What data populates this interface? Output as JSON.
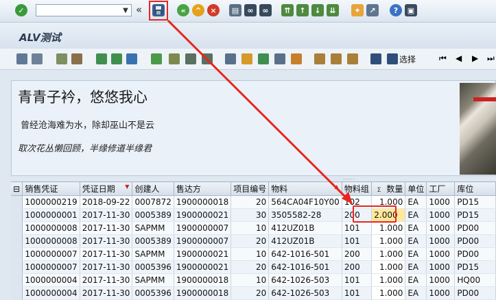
{
  "colors": {
    "highlight": "#e8251f",
    "toolbar_bg": "#dbe5ef",
    "row_alt": "#eef3fa",
    "edit_cell": "#ffe89b"
  },
  "toolbar": {
    "command_field": "",
    "icons": [
      "check-icon",
      "nav-back-icon",
      "save-icon",
      "back-icon",
      "exit-icon",
      "cancel-icon",
      "print-icon",
      "find-icon",
      "find-next-icon",
      "first-page-icon",
      "prev-page-icon",
      "next-page-icon",
      "last-page-icon",
      "create-session-icon",
      "shortcut-icon",
      "help-icon",
      "layout-icon"
    ]
  },
  "title": "ALV测试",
  "app_toolbar": {
    "select_label": "选择"
  },
  "header": {
    "line1": "青青子衿，悠悠我心",
    "line2": "曾经沧海难为水，除却巫山不是云",
    "line3": "取次花丛懒回顾，半缘修道半缘君",
    "separator": "....."
  },
  "grid": {
    "columns": [
      "销售凭证",
      "凭证日期",
      "创建人",
      "售达方",
      "项目编号",
      "物料",
      "物料组",
      "数量",
      "单位",
      "工厂",
      "库位"
    ],
    "sigma": "Σ",
    "rows": [
      [
        "1000000219",
        "2018-09-22",
        "0007872",
        "1900000018",
        "20",
        "564CA04F10Y00",
        "102",
        "1.000",
        "EA",
        "1000",
        "PD15"
      ],
      [
        "1000000001",
        "2017-11-30",
        "0005389",
        "1900000021",
        "30",
        "3505582-28",
        "200",
        "2.000",
        "EA",
        "1000",
        "PD15"
      ],
      [
        "1000000008",
        "2017-11-30",
        "SAPMM",
        "1900000007",
        "10",
        "412UZ01B",
        "101",
        "1.000",
        "EA",
        "1000",
        "PD00"
      ],
      [
        "1000000008",
        "2017-11-30",
        "0005389",
        "1900000007",
        "20",
        "412UZ01B",
        "101",
        "1.000",
        "EA",
        "1000",
        "PD00"
      ],
      [
        "1000000007",
        "2017-11-30",
        "SAPMM",
        "1900000021",
        "10",
        "642-1016-501",
        "200",
        "1.000",
        "EA",
        "1000",
        "PD00"
      ],
      [
        "1000000007",
        "2017-11-30",
        "0005396",
        "1900000021",
        "20",
        "642-1016-501",
        "200",
        "1.000",
        "EA",
        "1000",
        "PD15"
      ],
      [
        "1000000004",
        "2017-11-30",
        "SAPMM",
        "1900000018",
        "10",
        "642-1026-503",
        "101",
        "1.000",
        "EA",
        "1000",
        "HQ00"
      ],
      [
        "1000000004",
        "2017-11-30",
        "0005396",
        "1900000018",
        "20",
        "642-1026-503",
        "101",
        "1.000",
        "EA",
        "1000",
        "PD00"
      ]
    ]
  }
}
